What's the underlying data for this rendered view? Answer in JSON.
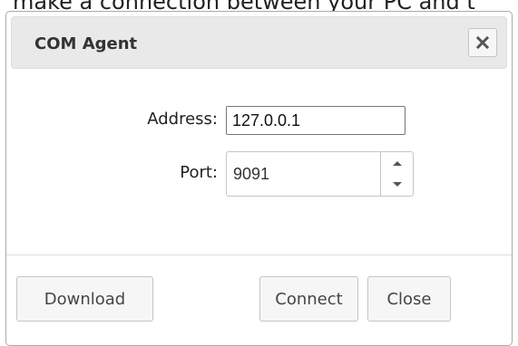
{
  "background": {
    "text": "make a connection between your PC and t"
  },
  "dialog": {
    "title": "COM Agent",
    "close_icon": "close-icon",
    "fields": {
      "address_label": "Address:",
      "address_value": "127.0.0.1",
      "port_label": "Port:",
      "port_value": "9091",
      "spinner_up_icon": "caret-up-icon",
      "spinner_down_icon": "caret-down-icon"
    },
    "buttons": {
      "download": "Download",
      "connect": "Connect",
      "close": "Close"
    }
  },
  "colors": {
    "titlebar_bg": "#e9e9e9",
    "button_bg": "#f6f6f6",
    "border": "#c5c5c5",
    "text": "#333333"
  }
}
